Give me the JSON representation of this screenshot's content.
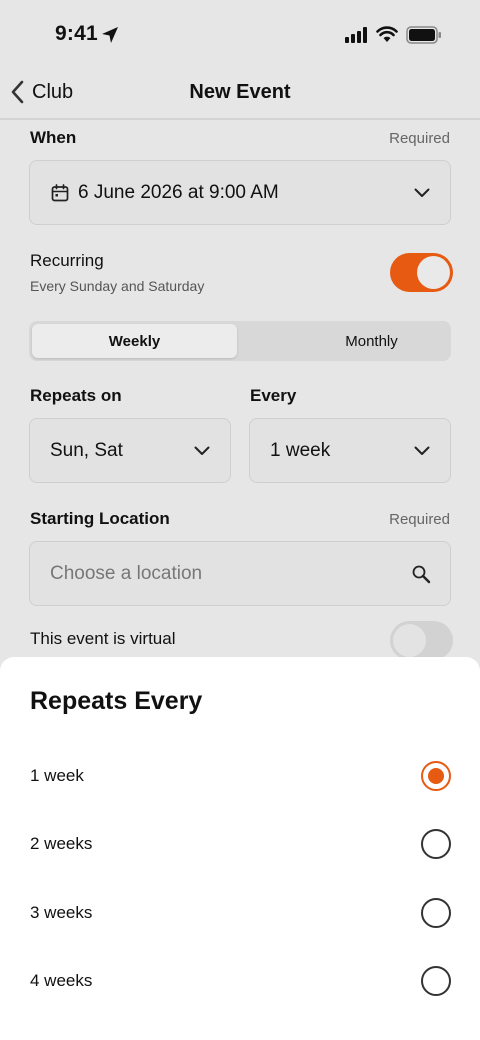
{
  "status_bar": {
    "time": "9:41"
  },
  "nav": {
    "back_label": "Club",
    "title": "New Event"
  },
  "when": {
    "label": "When",
    "required": "Required",
    "value": "6 June 2026 at 9:00 AM"
  },
  "recurring": {
    "title": "Recurring",
    "subtitle": "Every Sunday and Saturday",
    "enabled": true
  },
  "frequency_tabs": {
    "options": [
      "Weekly",
      "Monthly"
    ],
    "selected": "Weekly"
  },
  "repeats_on": {
    "label": "Repeats on",
    "value": "Sun, Sat"
  },
  "every": {
    "label": "Every",
    "value": "1 week"
  },
  "location": {
    "label": "Starting Location",
    "required": "Required",
    "placeholder": "Choose a location"
  },
  "virtual": {
    "label": "This event is virtual",
    "enabled": false
  },
  "sheet": {
    "title": "Repeats Every",
    "options": [
      "1 week",
      "2 weeks",
      "3 weeks",
      "4 weeks"
    ],
    "selected": "1 week"
  },
  "colors": {
    "accent": "#e65a12"
  }
}
